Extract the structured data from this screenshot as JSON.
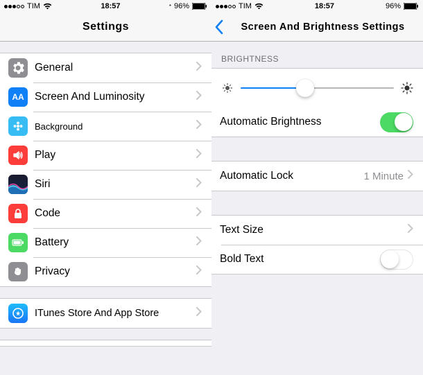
{
  "left": {
    "status": {
      "carrier": "TIM",
      "time": "18:57",
      "battery": "96%"
    },
    "nav": {
      "title": "Settings"
    },
    "items": {
      "general": "General",
      "screen": "Screen And Luminosity",
      "background": "Background",
      "play": "Play",
      "siri": "Siri",
      "code": "Code",
      "battery": "Battery",
      "privacy": "Privacy",
      "itunes": "ITunes Store And App Store"
    }
  },
  "right": {
    "status": {
      "carrier": "TIM",
      "time": "18:57",
      "battery": "96%"
    },
    "nav": {
      "title": "Screen And Brightness Settings"
    },
    "section_brightness": "BRIGHTNESS",
    "slider_position_pct": 42,
    "auto_brightness": {
      "label": "Automatic Brightness",
      "on": true
    },
    "auto_lock": {
      "label": "Automatic Lock",
      "value": "1 Minute"
    },
    "text_size": {
      "label": "Text Size"
    },
    "bold_text": {
      "label": "Bold Text",
      "on": false
    }
  }
}
